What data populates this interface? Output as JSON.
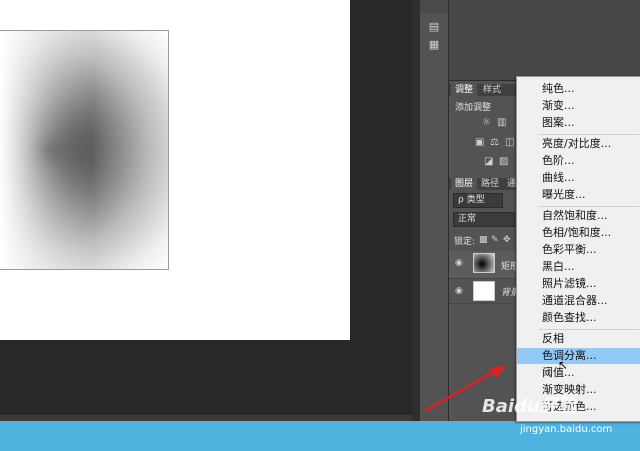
{
  "colors": {
    "menu_highlight": "#91c9f7",
    "arrow": "#e02020",
    "panel_bg": "#535353",
    "canvas_bg": "#282828",
    "desktop_bg": "#4fb3e0"
  },
  "adjust_panel": {
    "tabs": [
      "调整",
      "样式"
    ],
    "add_adjustment_label": "添加调整"
  },
  "layers_panel": {
    "tabs": [
      "图层",
      "路径",
      "通"
    ],
    "filter_kind": "ρ 类型",
    "blend_mode": "正常",
    "lock_label": "锁定:",
    "layers": [
      {
        "name": "矩形",
        "thumb": "gradient"
      },
      {
        "name": "背景",
        "thumb": "white"
      }
    ]
  },
  "context_menu": {
    "groups": [
      [
        "纯色...",
        "渐变...",
        "图案..."
      ],
      [
        "亮度/对比度...",
        "色阶...",
        "曲线...",
        "曝光度..."
      ],
      [
        "自然饱和度...",
        "色相/饱和度...",
        "色彩平衡...",
        "黑白...",
        "照片滤镜...",
        "通道混合器...",
        "颜色查找..."
      ],
      [
        "反相",
        "色调分离...",
        "阈值...",
        "渐变映射...",
        "可选颜色..."
      ]
    ],
    "selected": "色调分离..."
  },
  "watermark": {
    "logo": "Baidu经验",
    "url": "jingyan.baidu.com"
  }
}
